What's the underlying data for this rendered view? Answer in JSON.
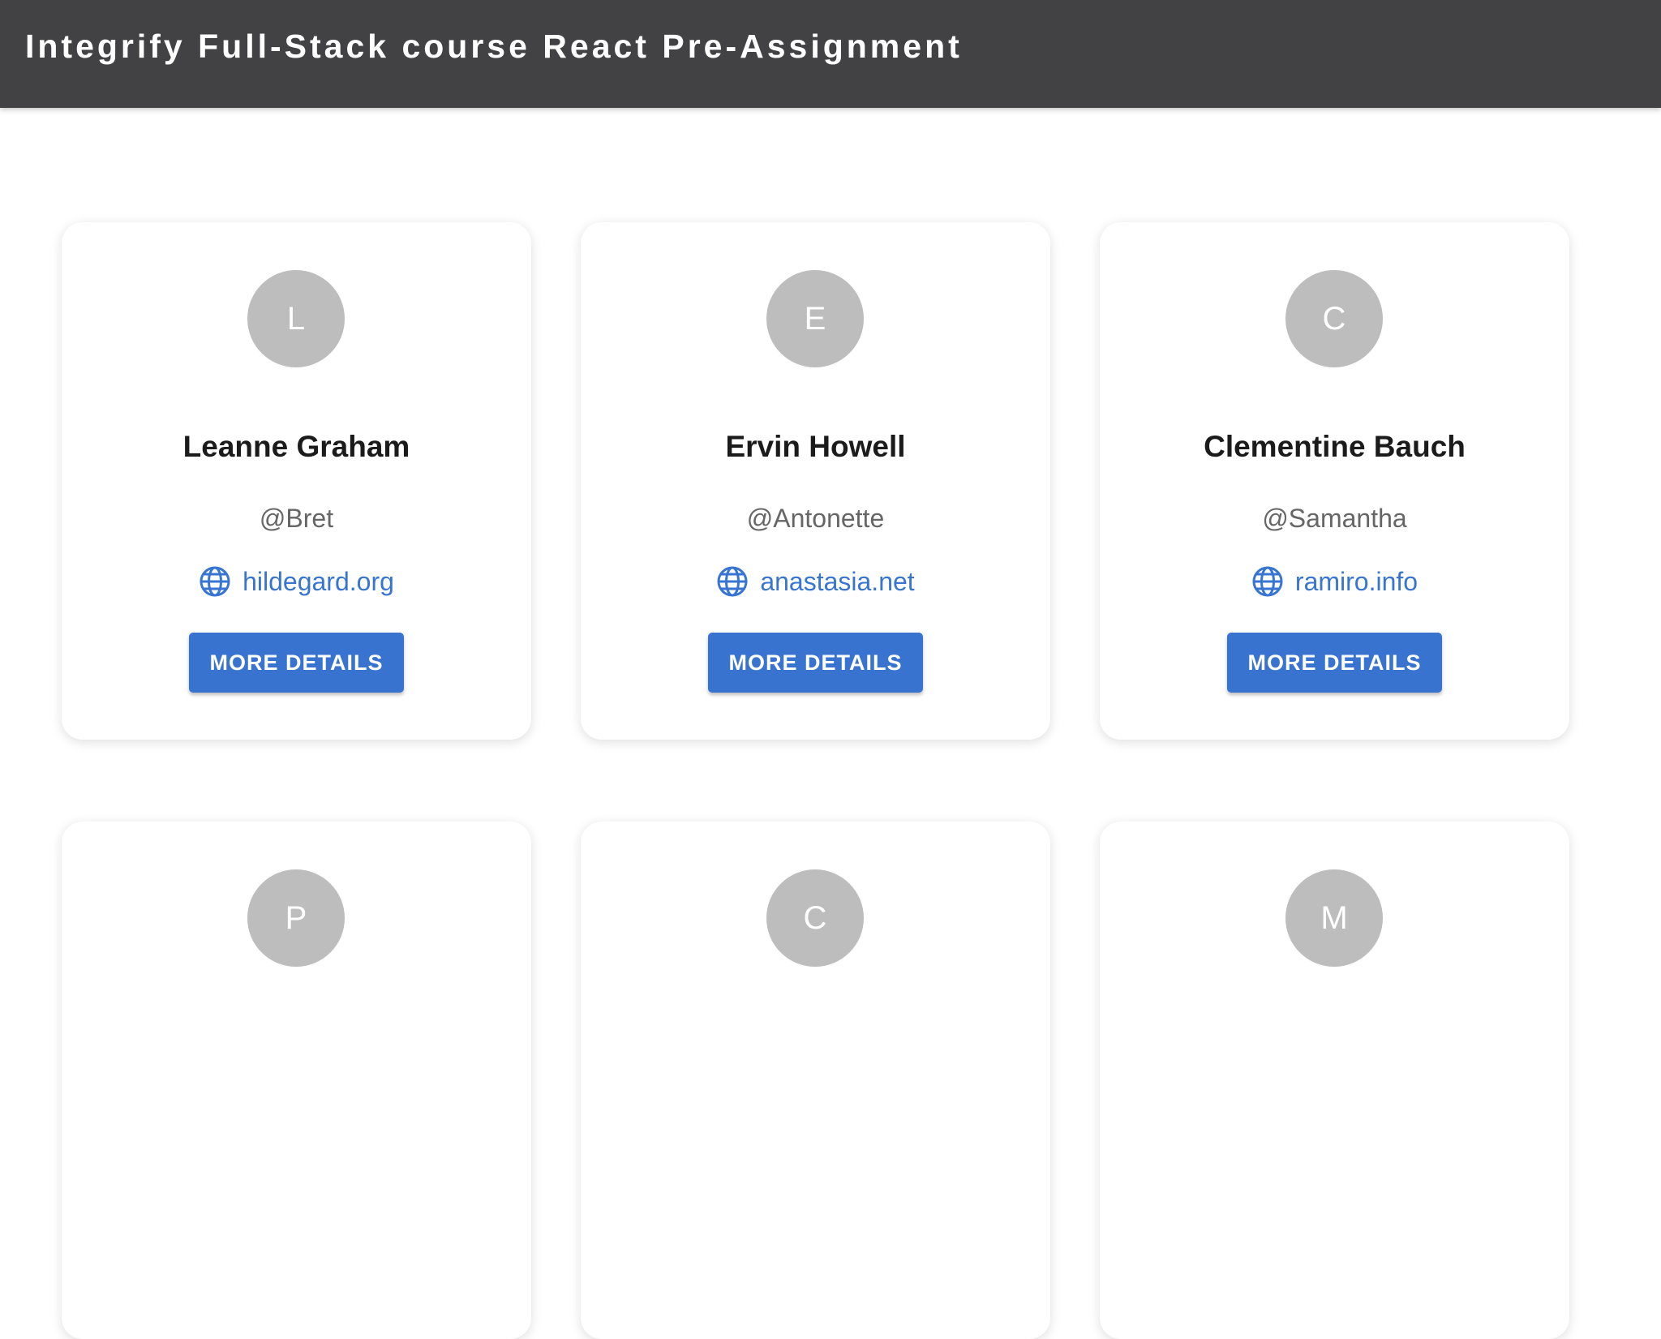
{
  "header": {
    "title": "Integrify Full-Stack course React Pre-Assignment"
  },
  "users": [
    {
      "initial": "L",
      "name": "Leanne Graham",
      "username": "@Bret",
      "website": "hildegard.org",
      "button_label": "MORE DETAILS"
    },
    {
      "initial": "E",
      "name": "Ervin Howell",
      "username": "@Antonette",
      "website": "anastasia.net",
      "button_label": "MORE DETAILS"
    },
    {
      "initial": "C",
      "name": "Clementine Bauch",
      "username": "@Samantha",
      "website": "ramiro.info",
      "button_label": "MORE DETAILS"
    },
    {
      "initial": "P"
    },
    {
      "initial": "C"
    },
    {
      "initial": "M"
    }
  ],
  "icons": {
    "website": "globe-icon"
  },
  "colors": {
    "app_bar": "#424244",
    "primary": "#3873cf",
    "link": "#3875d0",
    "avatar": "#bdbdbd"
  }
}
